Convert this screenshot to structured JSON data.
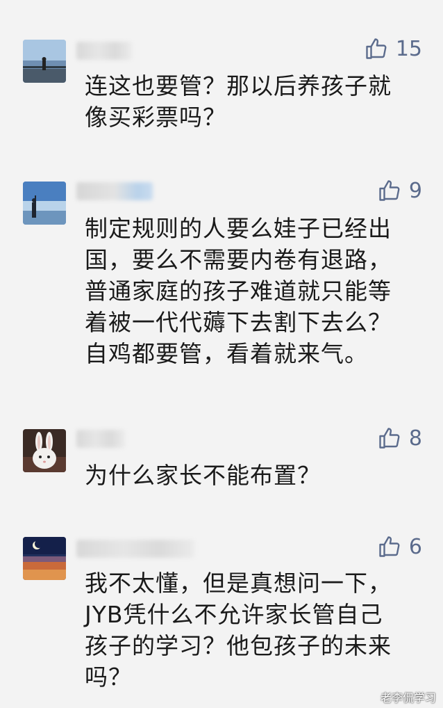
{
  "comments": [
    {
      "likes": "15",
      "text": "连这也要管？那以后养孩子就\n像买彩票吗？",
      "avatar": "lake-pier-photo"
    },
    {
      "likes": "9",
      "text": "制定规则的人要么娃子已经出\n国，要么不需要内卷有退路，\n普通家庭的孩子难道就只能等\n着被一代代薅下去割下去么？\n自鸡都要管，看着就来气。",
      "avatar": "person-by-sea-photo"
    },
    {
      "likes": "8",
      "text": "为什么家长不能布置？",
      "avatar": "white-rabbit-photo"
    },
    {
      "likes": "6",
      "text": "我不太懂，但是真想问一下，\nJYB凭什么不允许家长管自己\n孩子的学习？他包孩子的未来\n吗？",
      "avatar": "night-sky-moon-photo"
    }
  ],
  "icons": {
    "like": "thumbs-up-icon"
  },
  "colors": {
    "like": "#5b6b8c",
    "background": "#f3f3f3",
    "text": "#1a1a1a"
  },
  "watermark": "老李侃学习"
}
